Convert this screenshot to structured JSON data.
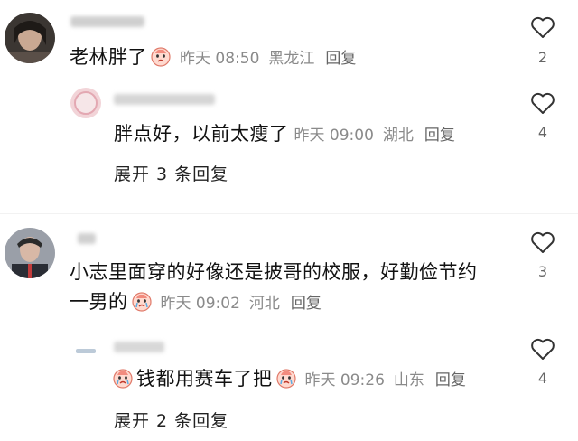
{
  "comments": [
    {
      "text": "老林胖了",
      "emoji": "crying-face-emoji",
      "time": "昨天 08:50",
      "location": "黑龙江",
      "reply_label": "回复",
      "likes": "2",
      "reply": {
        "text": "胖点好，以前太瘦了",
        "time": "昨天 09:00",
        "location": "湖北",
        "reply_label": "回复",
        "likes": "4"
      },
      "expand_label": "展开 3 条回复"
    },
    {
      "text_line1": "小志里面穿的好像还是披哥的校服，好勤俭节约",
      "text_line2": "一男的",
      "emoji": "crying-face-emoji",
      "time": "昨天 09:02",
      "location": "河北",
      "reply_label": "回复",
      "likes": "3",
      "reply": {
        "text": "钱都用赛车了把",
        "emoji": "crying-face-emoji",
        "time": "昨天 09:26",
        "location": "山东",
        "reply_label": "回复",
        "likes": "4"
      },
      "expand_label": "展开 2 条回复"
    }
  ],
  "colors": {
    "primary_text": "#111111",
    "meta_text": "#8a8a8a",
    "heart_stroke": "#333333"
  }
}
